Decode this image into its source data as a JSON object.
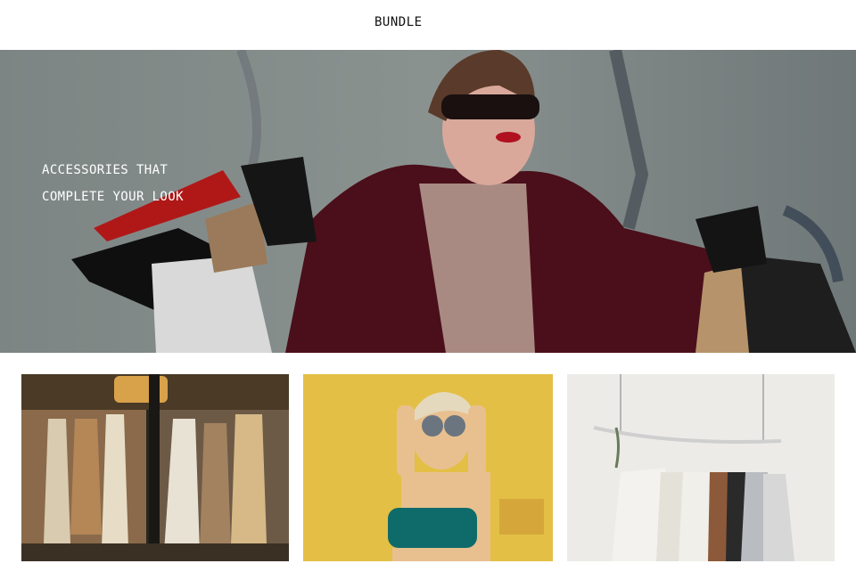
{
  "header": {
    "brand": "BUNDLE"
  },
  "hero": {
    "line1": "ACCESSORIES THAT",
    "line2": "COMPLETE YOUR LOOK",
    "image": "woman-with-shopping-bags-photo"
  },
  "tiles": [
    {
      "image": "clothing-rack-store-photo"
    },
    {
      "image": "woman-with-sunglasses-yellow-wall-photo"
    },
    {
      "image": "hanging-clothes-rack-white-photo"
    }
  ]
}
